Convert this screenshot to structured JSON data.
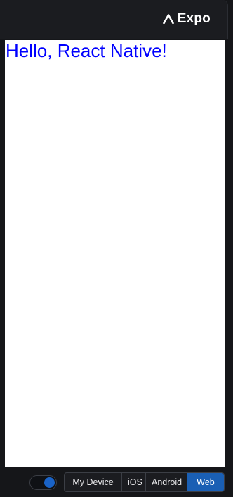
{
  "header": {
    "brand_label": "Expo",
    "brand_icon": "expo-chevron-icon"
  },
  "app": {
    "text": "Hello, React Native!",
    "text_color": "#0000ff",
    "background": "#ffffff"
  },
  "footer": {
    "toggle_on": true,
    "platforms": [
      {
        "label": "My Device",
        "active": false
      },
      {
        "label": "iOS",
        "active": false
      },
      {
        "label": "Android",
        "active": false
      },
      {
        "label": "Web",
        "active": true
      }
    ],
    "accent_color": "#1a5fb4"
  }
}
